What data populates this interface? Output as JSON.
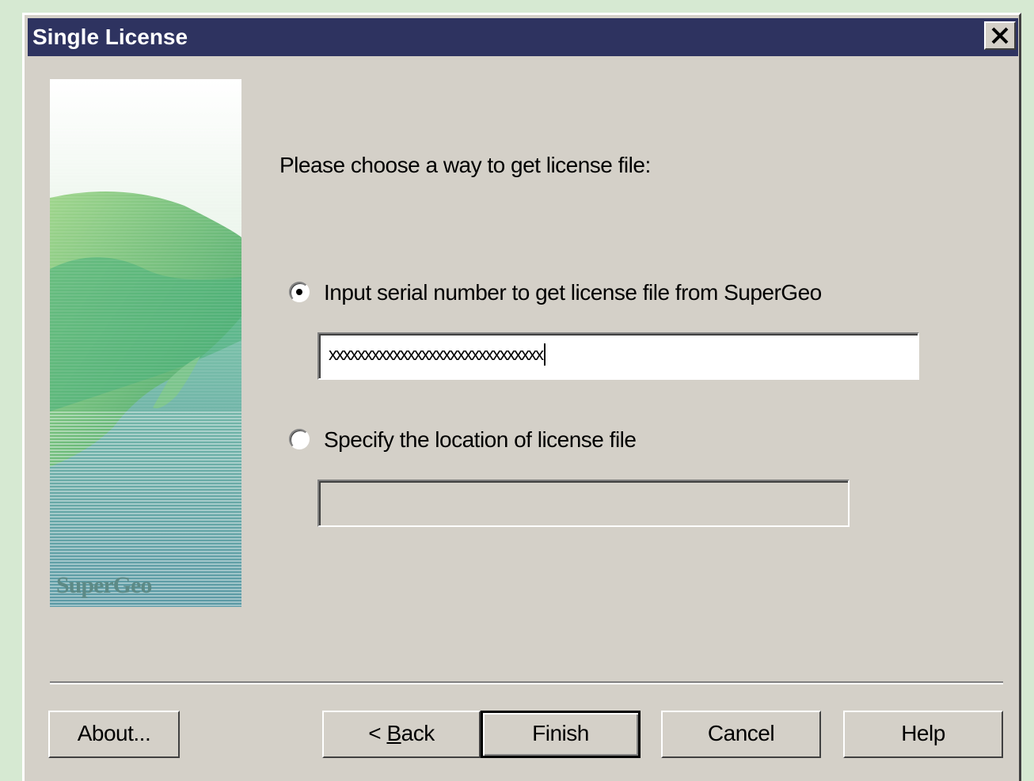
{
  "window": {
    "title": "Single License",
    "close_icon": "close-icon"
  },
  "side_image": {
    "logo_text": "SuperGeo"
  },
  "main": {
    "prompt": "Please choose a way to get license file:",
    "options": [
      {
        "label": "Input serial number to get license file from SuperGeo",
        "selected": true,
        "field_value": "xxxxxxxxxxxxxxxxxxxxxxxxxxxxxx",
        "field_enabled": true
      },
      {
        "label": "Specify the location of license file",
        "selected": false,
        "field_value": "",
        "field_enabled": false
      }
    ]
  },
  "buttons": {
    "about": "About...",
    "back_prefix": "< ",
    "back_accel": "B",
    "back_rest": "ack",
    "finish": "Finish",
    "cancel": "Cancel",
    "help": "Help"
  },
  "colors": {
    "titlebar": "#2e3360",
    "dialog_bg": "#d4d0c8",
    "desktop_bg": "#d6e9d2"
  }
}
